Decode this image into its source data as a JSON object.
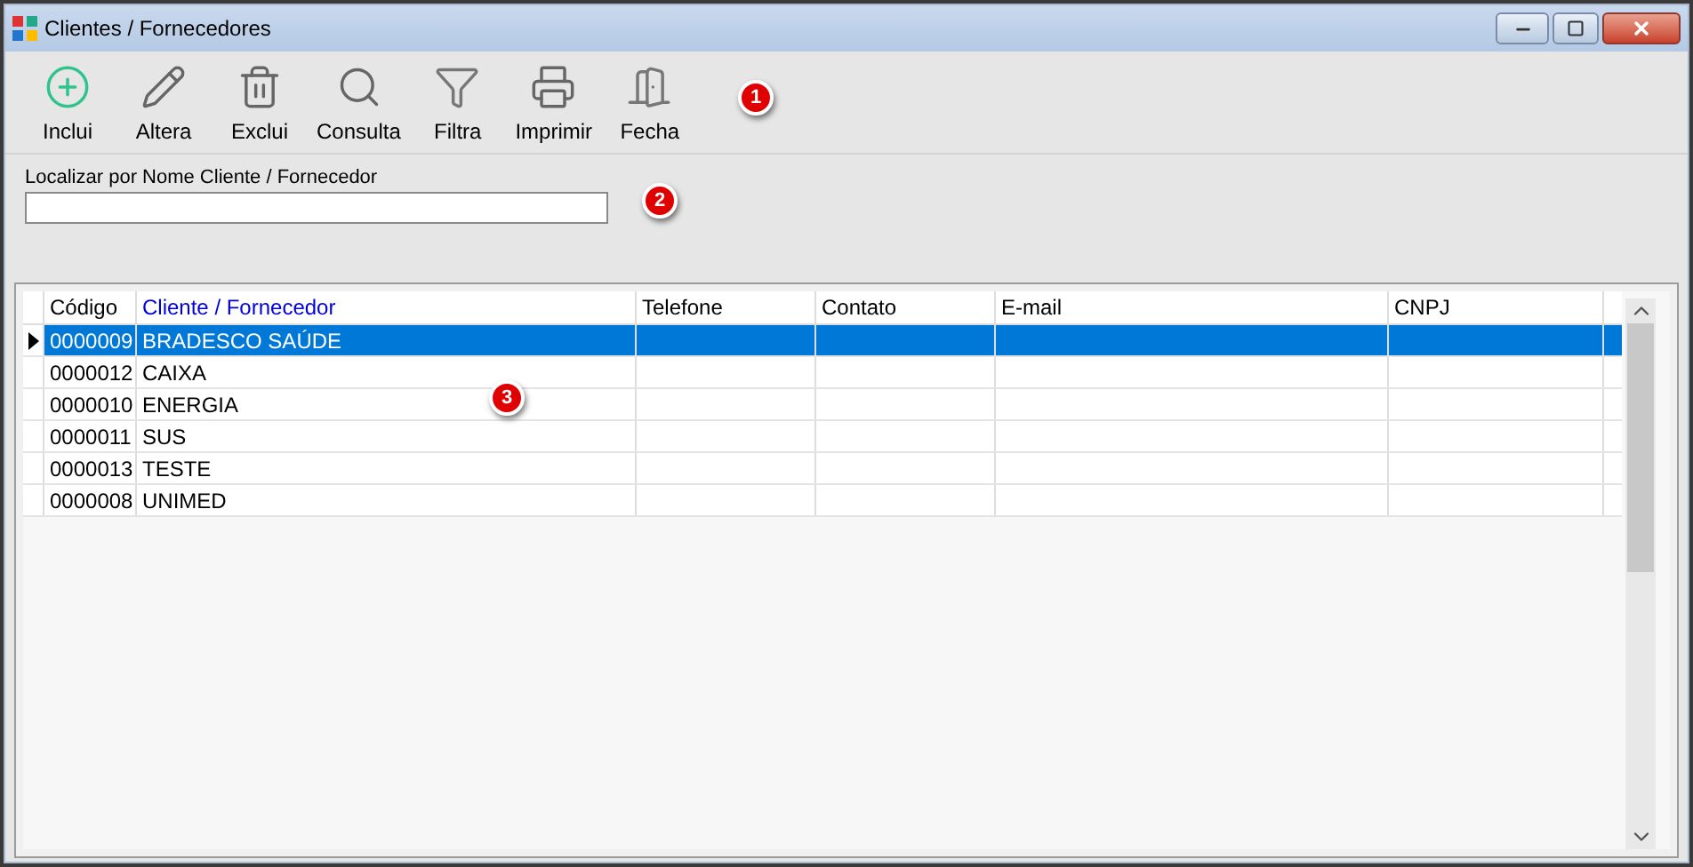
{
  "window": {
    "title": "Clientes / Fornecedores"
  },
  "toolbar": [
    {
      "kind": "add",
      "label": "Inclui"
    },
    {
      "kind": "edit",
      "label": "Altera"
    },
    {
      "kind": "delete",
      "label": "Exclui"
    },
    {
      "kind": "search",
      "label": "Consulta"
    },
    {
      "kind": "filter",
      "label": "Filtra"
    },
    {
      "kind": "print",
      "label": "Imprimir"
    },
    {
      "kind": "exit",
      "label": "Fecha"
    }
  ],
  "search": {
    "label": "Localizar por Nome Cliente / Fornecedor"
  },
  "callouts": [
    "1",
    "2",
    "3"
  ],
  "table": {
    "columns": [
      {
        "label": "Código",
        "sorted": false
      },
      {
        "label": "Cliente / Fornecedor",
        "sorted": true
      },
      {
        "label": "Telefone",
        "sorted": false
      },
      {
        "label": "Contato",
        "sorted": false
      },
      {
        "label": "E-mail",
        "sorted": false
      },
      {
        "label": "CNPJ",
        "sorted": false
      }
    ],
    "rows": [
      {
        "selected": true,
        "cells": [
          "0000009",
          "BRADESCO SAÚDE"
        ]
      },
      {
        "selected": false,
        "cells": [
          "0000012",
          "CAIXA"
        ]
      },
      {
        "selected": false,
        "cells": [
          "0000010",
          "ENERGIA"
        ]
      },
      {
        "selected": false,
        "cells": [
          "0000011",
          "SUS"
        ]
      },
      {
        "selected": false,
        "cells": [
          "0000013",
          "TESTE"
        ]
      },
      {
        "selected": false,
        "cells": [
          "0000008",
          "UNIMED"
        ]
      }
    ]
  }
}
